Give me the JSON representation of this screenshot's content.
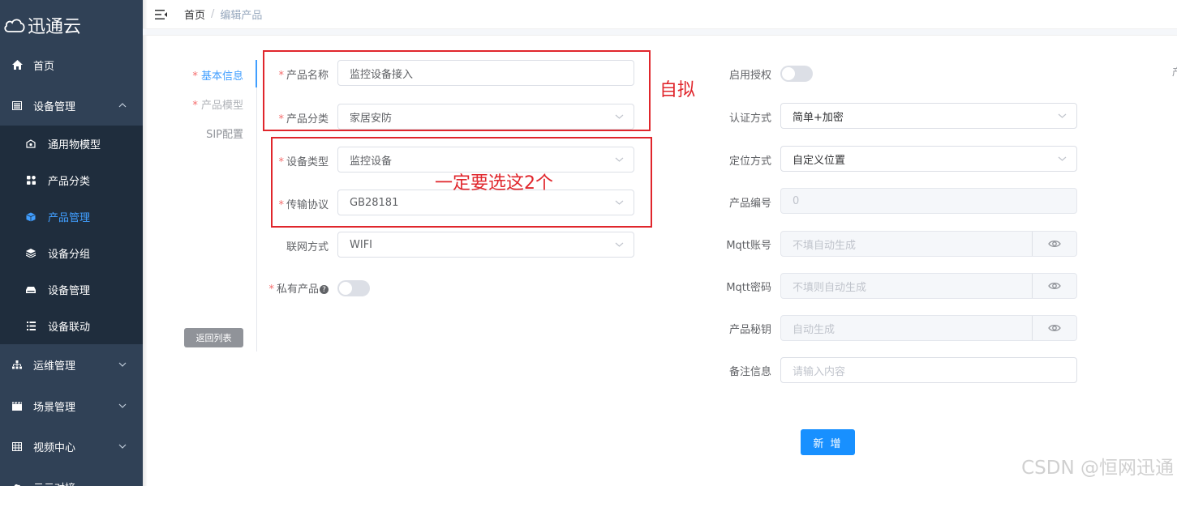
{
  "app": {
    "logo_text": "迅通云"
  },
  "sidebar": {
    "items": [
      {
        "label": "首页",
        "icon": "home-icon"
      },
      {
        "label": "设备管理",
        "icon": "device-icon",
        "expanded": true
      },
      {
        "label": "运维管理",
        "icon": "sitemap-icon"
      },
      {
        "label": "场景管理",
        "icon": "scene-icon"
      },
      {
        "label": "视频中心",
        "icon": "grid-icon"
      },
      {
        "label": "云云对接",
        "icon": "cloud-icon"
      }
    ],
    "sub_items": [
      {
        "label": "通用物模型",
        "icon": "model-icon"
      },
      {
        "label": "产品分类",
        "icon": "category-icon"
      },
      {
        "label": "产品管理",
        "icon": "cube-icon",
        "active": true
      },
      {
        "label": "设备分组",
        "icon": "layers-icon"
      },
      {
        "label": "设备管理",
        "icon": "device-box-icon"
      },
      {
        "label": "设备联动",
        "icon": "list-icon"
      }
    ]
  },
  "breadcrumb": {
    "home": "首页",
    "separator": "/",
    "current": "编辑产品"
  },
  "steps": [
    {
      "label": "基本信息",
      "required": true,
      "state": "active"
    },
    {
      "label": "产品模型",
      "required": true,
      "state": "disabled"
    },
    {
      "label": "SIP配置",
      "required": false,
      "state": "normal"
    }
  ],
  "back_button": "返回列表",
  "form_left": {
    "product_name": {
      "label": "产品名称",
      "value": "监控设备接入"
    },
    "product_category": {
      "label": "产品分类",
      "value": "家居安防"
    },
    "device_type": {
      "label": "设备类型",
      "value": "监控设备"
    },
    "transport_protocol": {
      "label": "传输协议",
      "value": "GB28181"
    },
    "network_mode": {
      "label": "联网方式",
      "value": "WIFI"
    },
    "private_product": {
      "label": "私有产品",
      "help": "?",
      "enabled": false
    }
  },
  "form_right": {
    "enable_auth": {
      "label": "启用授权",
      "enabled": false
    },
    "auth_method": {
      "label": "认证方式",
      "value": "简单+加密"
    },
    "location_method": {
      "label": "定位方式",
      "value": "自定义位置"
    },
    "product_number": {
      "label": "产品编号",
      "value": "0"
    },
    "mqtt_account": {
      "label": "Mqtt账号",
      "placeholder": "不填自动生成"
    },
    "mqtt_password": {
      "label": "Mqtt密码",
      "placeholder": "不填则自动生成"
    },
    "product_secret": {
      "label": "产品秘钥",
      "placeholder": "自动生成"
    },
    "remarks": {
      "label": "备注信息",
      "placeholder": "请输入内容"
    }
  },
  "submit_button": "新 增",
  "annotations": {
    "box1": "自拟",
    "box2": "一定要选这2个"
  },
  "watermark": "CSDN @恒网迅通",
  "edge_char": "产",
  "colors": {
    "sidebar_bg": "#304156",
    "submenu_bg": "#1f2d3d",
    "primary": "#1890ff",
    "active_text": "#409eff",
    "annotation_red": "#e0262c"
  }
}
